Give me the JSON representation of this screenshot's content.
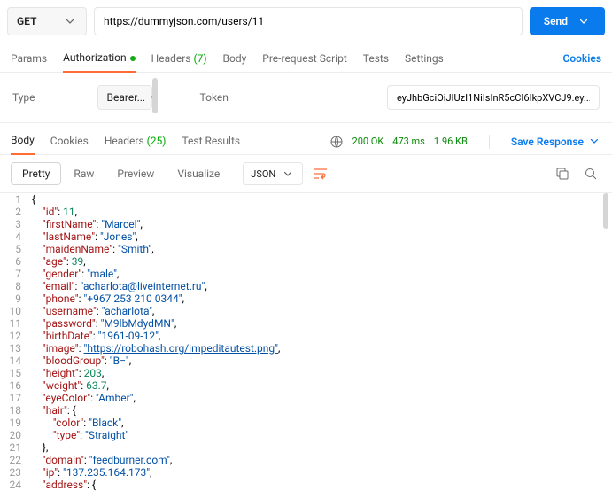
{
  "request": {
    "method": "GET",
    "url": "https://dummyjson.com/users/11",
    "send": "Send"
  },
  "tabs": {
    "params": "Params",
    "auth": "Authorization",
    "headers": "Headers",
    "headers_count": "(7)",
    "body": "Body",
    "prereq": "Pre-request Script",
    "tests": "Tests",
    "settings": "Settings",
    "cookies": "Cookies"
  },
  "auth": {
    "type_label": "Type",
    "type_value": "Bearer...",
    "token_label": "Token",
    "token_value": "eyJhbGciOiJIUzI1NiIsInR5cCI6IkpXVCJ9.ey..."
  },
  "resp_tabs": {
    "body": "Body",
    "cookies": "Cookies",
    "headers": "Headers",
    "headers_count": "(25)",
    "test_results": "Test Results"
  },
  "status": {
    "code": "200 OK",
    "time": "473 ms",
    "size": "1.96 KB",
    "save": "Save Response"
  },
  "view": {
    "pretty": "Pretty",
    "raw": "Raw",
    "preview": "Preview",
    "visualize": "Visualize",
    "json": "JSON"
  },
  "body": [
    {
      "i": "1",
      "t": [
        {
          "c": "p",
          "v": "{"
        }
      ]
    },
    {
      "i": "2",
      "t": [
        {
          "c": "p",
          "v": "    "
        },
        {
          "c": "k",
          "v": "\"id\""
        },
        {
          "c": "p",
          "v": ": "
        },
        {
          "c": "n",
          "v": "11"
        },
        {
          "c": "p",
          "v": ","
        }
      ]
    },
    {
      "i": "3",
      "t": [
        {
          "c": "p",
          "v": "    "
        },
        {
          "c": "k",
          "v": "\"firstName\""
        },
        {
          "c": "p",
          "v": ": "
        },
        {
          "c": "s",
          "v": "\"Marcel\""
        },
        {
          "c": "p",
          "v": ","
        }
      ]
    },
    {
      "i": "4",
      "t": [
        {
          "c": "p",
          "v": "    "
        },
        {
          "c": "k",
          "v": "\"lastName\""
        },
        {
          "c": "p",
          "v": ": "
        },
        {
          "c": "s",
          "v": "\"Jones\""
        },
        {
          "c": "p",
          "v": ","
        }
      ]
    },
    {
      "i": "5",
      "t": [
        {
          "c": "p",
          "v": "    "
        },
        {
          "c": "k",
          "v": "\"maidenName\""
        },
        {
          "c": "p",
          "v": ": "
        },
        {
          "c": "s",
          "v": "\"Smith\""
        },
        {
          "c": "p",
          "v": ","
        }
      ]
    },
    {
      "i": "6",
      "t": [
        {
          "c": "p",
          "v": "    "
        },
        {
          "c": "k",
          "v": "\"age\""
        },
        {
          "c": "p",
          "v": ": "
        },
        {
          "c": "n",
          "v": "39"
        },
        {
          "c": "p",
          "v": ","
        }
      ]
    },
    {
      "i": "7",
      "t": [
        {
          "c": "p",
          "v": "    "
        },
        {
          "c": "k",
          "v": "\"gender\""
        },
        {
          "c": "p",
          "v": ": "
        },
        {
          "c": "s",
          "v": "\"male\""
        },
        {
          "c": "p",
          "v": ","
        }
      ]
    },
    {
      "i": "8",
      "t": [
        {
          "c": "p",
          "v": "    "
        },
        {
          "c": "k",
          "v": "\"email\""
        },
        {
          "c": "p",
          "v": ": "
        },
        {
          "c": "s",
          "v": "\"acharlota@liveinternet.ru\""
        },
        {
          "c": "p",
          "v": ","
        }
      ]
    },
    {
      "i": "9",
      "t": [
        {
          "c": "p",
          "v": "    "
        },
        {
          "c": "k",
          "v": "\"phone\""
        },
        {
          "c": "p",
          "v": ": "
        },
        {
          "c": "s",
          "v": "\"+967 253 210 0344\""
        },
        {
          "c": "p",
          "v": ","
        }
      ]
    },
    {
      "i": "10",
      "t": [
        {
          "c": "p",
          "v": "    "
        },
        {
          "c": "k",
          "v": "\"username\""
        },
        {
          "c": "p",
          "v": ": "
        },
        {
          "c": "s",
          "v": "\"acharlota\""
        },
        {
          "c": "p",
          "v": ","
        }
      ]
    },
    {
      "i": "11",
      "t": [
        {
          "c": "p",
          "v": "    "
        },
        {
          "c": "k",
          "v": "\"password\""
        },
        {
          "c": "p",
          "v": ": "
        },
        {
          "c": "s",
          "v": "\"M9lbMdydMN\""
        },
        {
          "c": "p",
          "v": ","
        }
      ]
    },
    {
      "i": "12",
      "t": [
        {
          "c": "p",
          "v": "    "
        },
        {
          "c": "k",
          "v": "\"birthDate\""
        },
        {
          "c": "p",
          "v": ": "
        },
        {
          "c": "s",
          "v": "\"1961-09-12\""
        },
        {
          "c": "p",
          "v": ","
        }
      ]
    },
    {
      "i": "13",
      "t": [
        {
          "c": "p",
          "v": "    "
        },
        {
          "c": "k",
          "v": "\"image\""
        },
        {
          "c": "p",
          "v": ": "
        },
        {
          "c": "s u",
          "v": "\"https://robohash.org/impeditautest.png\""
        },
        {
          "c": "p",
          "v": ","
        }
      ]
    },
    {
      "i": "14",
      "t": [
        {
          "c": "p",
          "v": "    "
        },
        {
          "c": "k",
          "v": "\"bloodGroup\""
        },
        {
          "c": "p",
          "v": ": "
        },
        {
          "c": "s",
          "v": "\"B−\""
        },
        {
          "c": "p",
          "v": ","
        }
      ]
    },
    {
      "i": "15",
      "t": [
        {
          "c": "p",
          "v": "    "
        },
        {
          "c": "k",
          "v": "\"height\""
        },
        {
          "c": "p",
          "v": ": "
        },
        {
          "c": "n",
          "v": "203"
        },
        {
          "c": "p",
          "v": ","
        }
      ]
    },
    {
      "i": "16",
      "t": [
        {
          "c": "p",
          "v": "    "
        },
        {
          "c": "k",
          "v": "\"weight\""
        },
        {
          "c": "p",
          "v": ": "
        },
        {
          "c": "n",
          "v": "63.7"
        },
        {
          "c": "p",
          "v": ","
        }
      ]
    },
    {
      "i": "17",
      "t": [
        {
          "c": "p",
          "v": "    "
        },
        {
          "c": "k",
          "v": "\"eyeColor\""
        },
        {
          "c": "p",
          "v": ": "
        },
        {
          "c": "s",
          "v": "\"Amber\""
        },
        {
          "c": "p",
          "v": ","
        }
      ]
    },
    {
      "i": "18",
      "t": [
        {
          "c": "p",
          "v": "    "
        },
        {
          "c": "k",
          "v": "\"hair\""
        },
        {
          "c": "p",
          "v": ": {"
        }
      ]
    },
    {
      "i": "19",
      "t": [
        {
          "c": "p",
          "v": "        "
        },
        {
          "c": "k",
          "v": "\"color\""
        },
        {
          "c": "p",
          "v": ": "
        },
        {
          "c": "s",
          "v": "\"Black\""
        },
        {
          "c": "p",
          "v": ","
        }
      ]
    },
    {
      "i": "20",
      "t": [
        {
          "c": "p",
          "v": "        "
        },
        {
          "c": "k",
          "v": "\"type\""
        },
        {
          "c": "p",
          "v": ": "
        },
        {
          "c": "s",
          "v": "\"Straight\""
        }
      ]
    },
    {
      "i": "21",
      "t": [
        {
          "c": "p",
          "v": "    },"
        }
      ]
    },
    {
      "i": "22",
      "t": [
        {
          "c": "p",
          "v": "    "
        },
        {
          "c": "k",
          "v": "\"domain\""
        },
        {
          "c": "p",
          "v": ": "
        },
        {
          "c": "s",
          "v": "\"feedburner.com\""
        },
        {
          "c": "p",
          "v": ","
        }
      ]
    },
    {
      "i": "23",
      "t": [
        {
          "c": "p",
          "v": "    "
        },
        {
          "c": "k",
          "v": "\"ip\""
        },
        {
          "c": "p",
          "v": ": "
        },
        {
          "c": "s",
          "v": "\"137.235.164.173\""
        },
        {
          "c": "p",
          "v": ","
        }
      ]
    },
    {
      "i": "24",
      "t": [
        {
          "c": "p",
          "v": "    "
        },
        {
          "c": "k",
          "v": "\"address\""
        },
        {
          "c": "p",
          "v": ": {"
        }
      ]
    }
  ]
}
